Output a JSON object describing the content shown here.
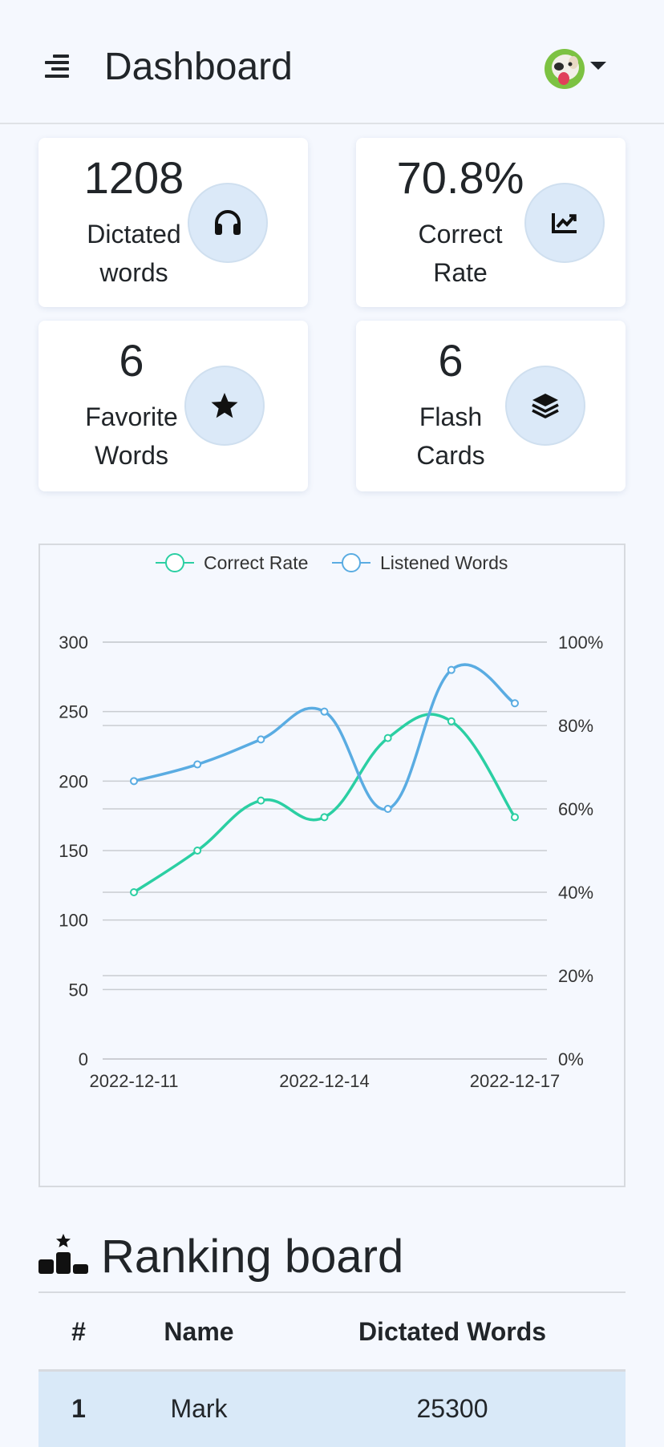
{
  "header": {
    "title": "Dashboard"
  },
  "stats": [
    {
      "value": "1208",
      "label_line1": "Dictated",
      "label_line2": "words",
      "icon": "headphones-icon"
    },
    {
      "value": "70.8%",
      "label_line1": "Correct",
      "label_line2": "Rate",
      "icon": "chart-line-icon"
    },
    {
      "value": "6",
      "label_line1": "Favorite",
      "label_line2": "Words",
      "icon": "star-icon"
    },
    {
      "value": "6",
      "label_line1": "Flash",
      "label_line2": "Cards",
      "icon": "layers-icon"
    }
  ],
  "colors": {
    "accent": "#dbe9f8",
    "correct_rate": "#2bcfa3",
    "listened_words": "#5aace2"
  },
  "chart_data": {
    "type": "line",
    "x": [
      "2022-12-11",
      "2022-12-12",
      "2022-12-13",
      "2022-12-14",
      "2022-12-15",
      "2022-12-16",
      "2022-12-17"
    ],
    "x_tick_labels": [
      "2022-12-11",
      "2022-12-14",
      "2022-12-17"
    ],
    "series": [
      {
        "name": "Correct Rate",
        "axis": "right",
        "values": [
          40,
          50,
          62,
          58,
          77,
          81,
          58
        ]
      },
      {
        "name": "Listened Words",
        "axis": "left",
        "values": [
          200,
          212,
          230,
          250,
          180,
          280,
          256
        ]
      }
    ],
    "y_left": {
      "ticks": [
        "0",
        "50",
        "100",
        "150",
        "200",
        "250",
        "300"
      ],
      "lim": [
        0,
        300
      ]
    },
    "y_right": {
      "ticks": [
        "0%",
        "20%",
        "40%",
        "60%",
        "80%",
        "100%"
      ],
      "lim": [
        0,
        100
      ]
    },
    "legend": "top-center",
    "grid": true
  },
  "ranking": {
    "title": "Ranking board",
    "columns": [
      "#",
      "Name",
      "Dictated Words"
    ],
    "rows": [
      {
        "rank": "1",
        "name": "Mark",
        "words": "25300"
      }
    ]
  }
}
